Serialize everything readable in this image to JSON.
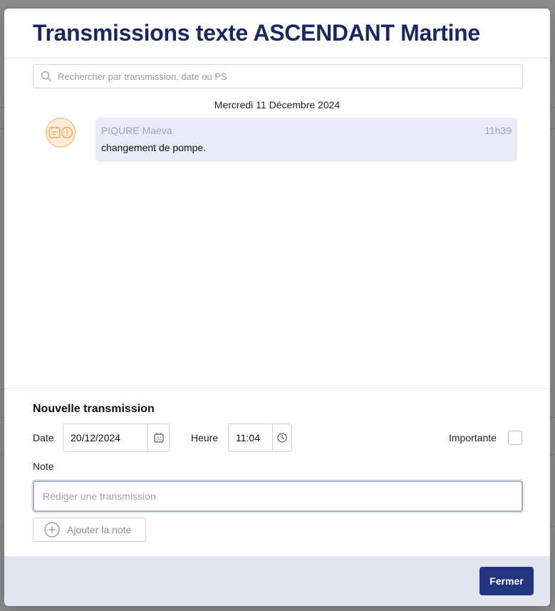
{
  "modal": {
    "title": "Transmissions texte ASCENDANT Martine"
  },
  "search": {
    "placeholder": "Rechercher par transmission, date ou PS"
  },
  "timeline": {
    "date_separator": "Mercredi 11 Décembre 2024",
    "messages": [
      {
        "author": "PIQURE Maeva",
        "time": "11h39",
        "text": "changement de pompe."
      }
    ]
  },
  "form": {
    "title": "Nouvelle transmission",
    "date_label": "Date",
    "date_value": "20/12/2024",
    "time_label": "Heure",
    "time_value": "11:04",
    "important_label": "Importante",
    "note_label": "Note",
    "note_placeholder": "Rédiger une transmission",
    "add_note_label": "Ajouter la note"
  },
  "footer": {
    "close_label": "Fermer"
  },
  "colors": {
    "title": "#1b2760",
    "primary_button": "#243580",
    "bubble_bg": "#e9ecf8",
    "footer_bg": "#e3e6f1",
    "avatar_accent": "#f0b070"
  }
}
